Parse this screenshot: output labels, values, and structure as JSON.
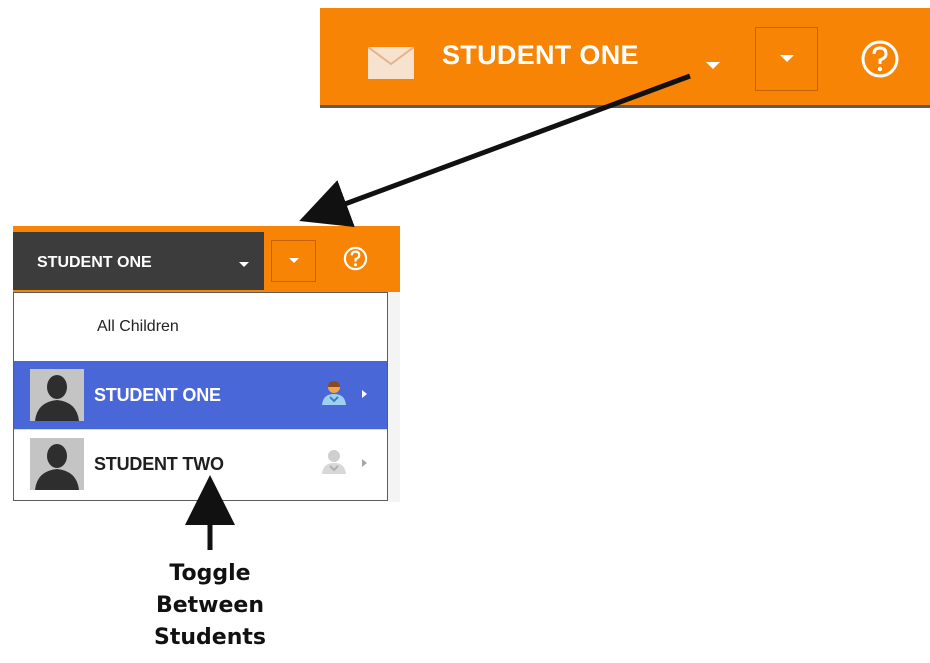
{
  "top_header": {
    "student_name": "STUDENT ONE",
    "icons": [
      "mail-icon",
      "chevron-down-icon",
      "dropdown-button",
      "help-icon"
    ]
  },
  "menu_header": {
    "student_name": "STUDENT ONE",
    "icons": [
      "chevron-down-icon",
      "dropdown-button",
      "help-icon"
    ]
  },
  "dropdown": {
    "all_label": "All Children",
    "items": [
      {
        "name": "STUDENT ONE",
        "selected": true,
        "avatar": "student-avatar-icon",
        "status_icon": "active-person-icon"
      },
      {
        "name": "STUDENT TWO",
        "selected": false,
        "avatar": "student-avatar-icon",
        "status_icon": "inactive-person-icon"
      }
    ]
  },
  "annotation": {
    "caption": [
      "Toggle",
      "Between",
      "Students"
    ]
  },
  "colors": {
    "header_orange": "#f88405",
    "name_box_dark": "#3c3c3c",
    "selected_row_blue": "#4a67d8",
    "text_white": "#ffffff"
  }
}
